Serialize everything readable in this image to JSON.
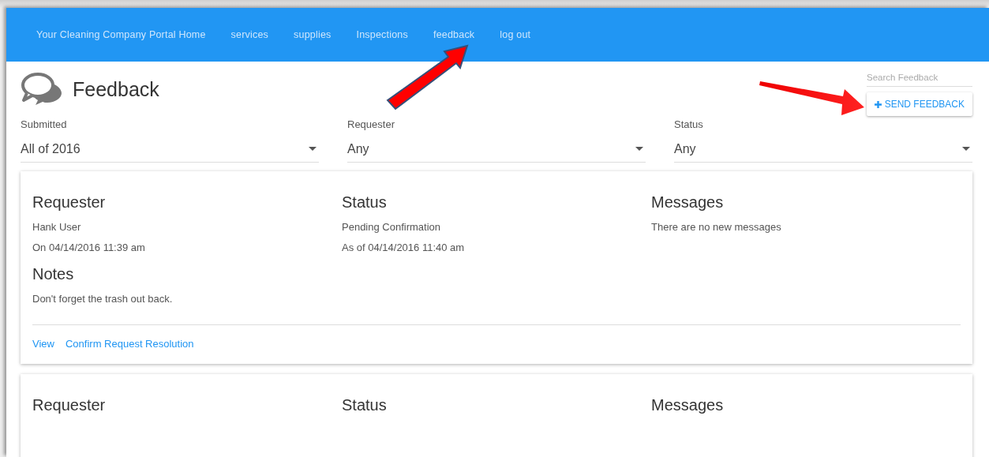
{
  "nav": {
    "brand": "Your Cleaning Company Portal Home",
    "links": [
      "services",
      "supplies",
      "Inspections",
      "feedback",
      "log out"
    ]
  },
  "page": {
    "title": "Feedback",
    "search": {
      "placeholder": "Search Feedback"
    },
    "send_button": "SEND FEEDBACK"
  },
  "filters": [
    {
      "label": "Submitted",
      "value": "All of 2016"
    },
    {
      "label": "Requester",
      "value": "Any"
    },
    {
      "label": "Status",
      "value": "Any"
    }
  ],
  "cards": [
    {
      "columns": [
        {
          "heading": "Requester",
          "lines": [
            "Hank User",
            "On 04/14/2016 11:39 am"
          ]
        },
        {
          "heading": "Status",
          "lines": [
            "Pending Confirmation",
            "As of 04/14/2016 11:40 am"
          ]
        },
        {
          "heading": "Messages",
          "lines": [
            "There are no new messages"
          ]
        }
      ],
      "notes": {
        "heading": "Notes",
        "text": "Don't forget the trash out back."
      },
      "actions": [
        "View",
        "Confirm Request Resolution"
      ]
    },
    {
      "columns": [
        {
          "heading": "Requester"
        },
        {
          "heading": "Status"
        },
        {
          "heading": "Messages"
        }
      ]
    }
  ]
}
